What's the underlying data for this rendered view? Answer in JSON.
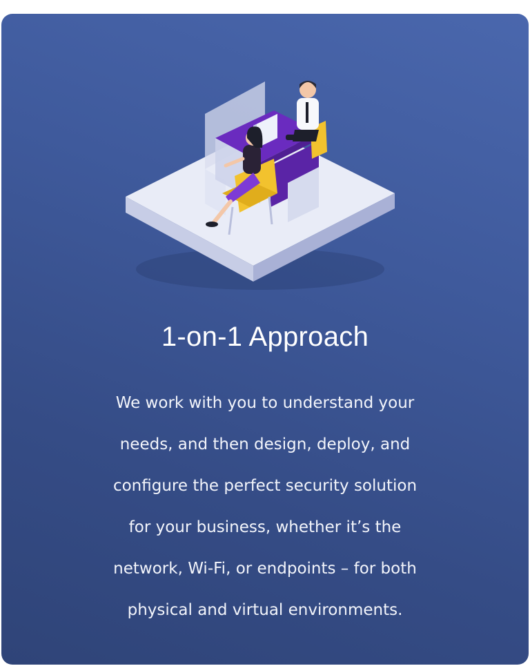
{
  "card": {
    "title": "1-on-1 Approach",
    "description_lines": [
      "We work with you to understand your",
      "needs, and then design, deploy, and",
      "configure the perfect security solution",
      "for your business, whether it’s the",
      "network, Wi-Fi, or endpoints – for both",
      "physical and virtual environments."
    ]
  },
  "colors": {
    "card_gradient_top": "#4a67ad",
    "card_gradient_bottom": "#2f4478",
    "text": "#ffffff",
    "accent_purple": "#6a2bbf",
    "accent_yellow": "#f2c22e"
  },
  "illustration": {
    "icon": "isometric-desk-meeting-illustration"
  }
}
